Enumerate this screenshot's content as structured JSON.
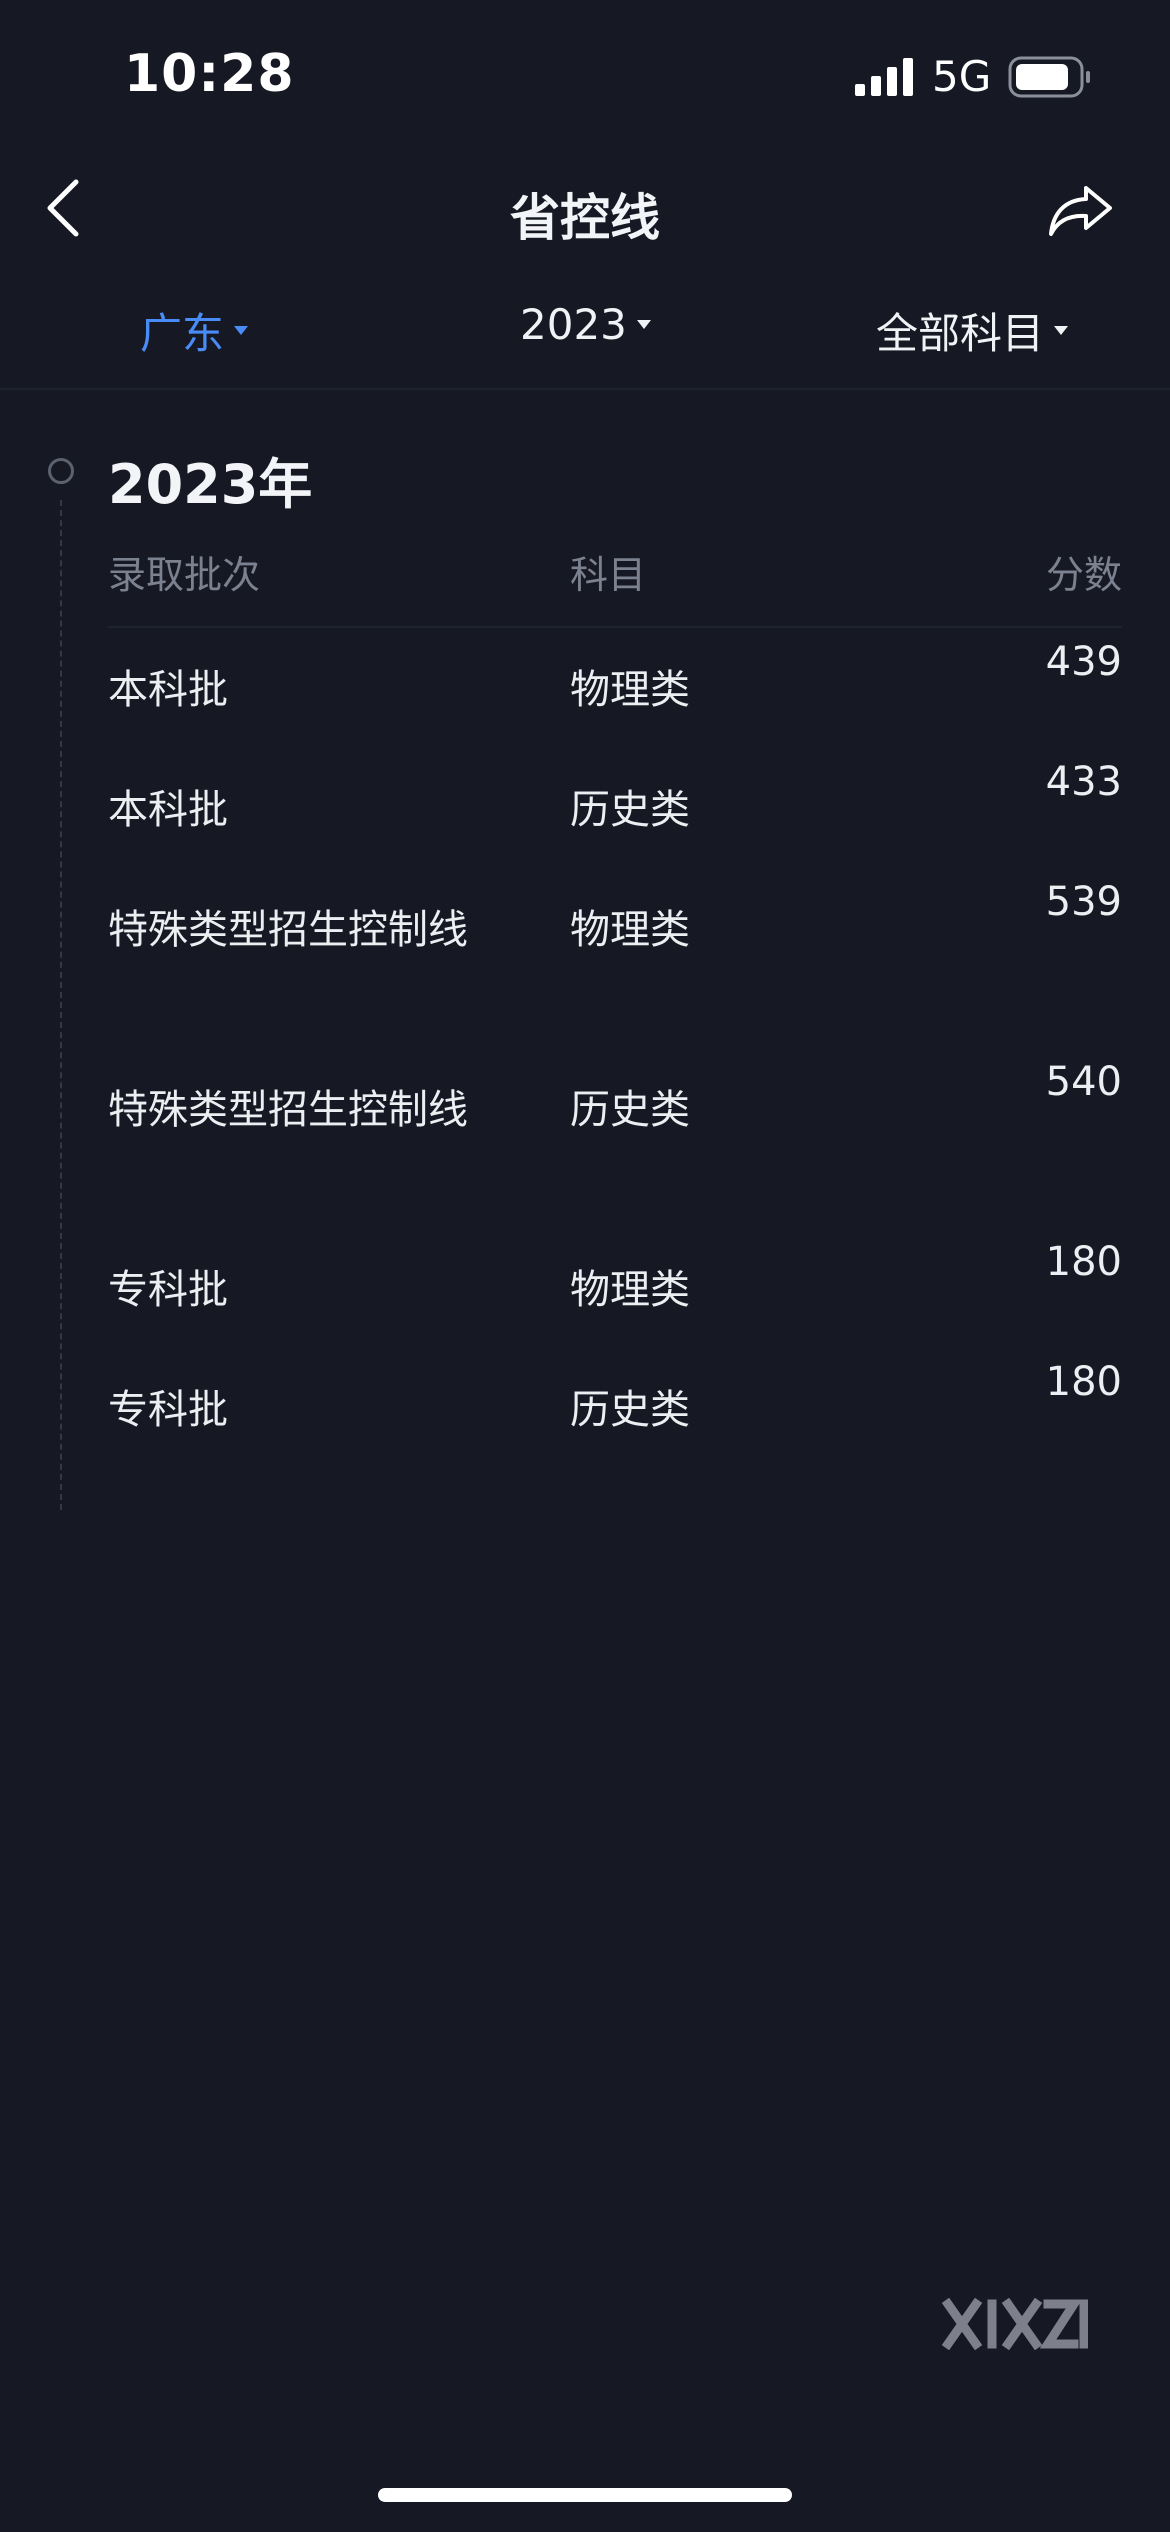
{
  "status_bar": {
    "time": "10:28",
    "network": "5G",
    "icons": [
      "signal-icon",
      "battery-icon"
    ]
  },
  "nav": {
    "title": "省控线",
    "icons": [
      "back-icon",
      "share-icon"
    ]
  },
  "filters": {
    "province": "广东",
    "year": "2023",
    "subject": "全部科目",
    "active_color": "#4a8cf7"
  },
  "section": {
    "year_heading": "2023年"
  },
  "table": {
    "headers": {
      "batch": "录取批次",
      "subject": "科目",
      "score": "分数"
    },
    "rows": [
      {
        "batch": "本科批",
        "subject": "物理类",
        "score": "439"
      },
      {
        "batch": "本科批",
        "subject": "历史类",
        "score": "433"
      },
      {
        "batch": "特殊类型招生控制线",
        "subject": "物理类",
        "score": "539"
      },
      {
        "batch": "特殊类型招生控制线",
        "subject": "历史类",
        "score": "540"
      },
      {
        "batch": "专科批",
        "subject": "物理类",
        "score": "180"
      },
      {
        "batch": "专科批",
        "subject": "历史类",
        "score": "180"
      }
    ]
  },
  "watermark": {
    "logo": "XIZI"
  },
  "colors": {
    "background": "#161923",
    "text": "#eceef2",
    "muted": "#7c8190"
  }
}
